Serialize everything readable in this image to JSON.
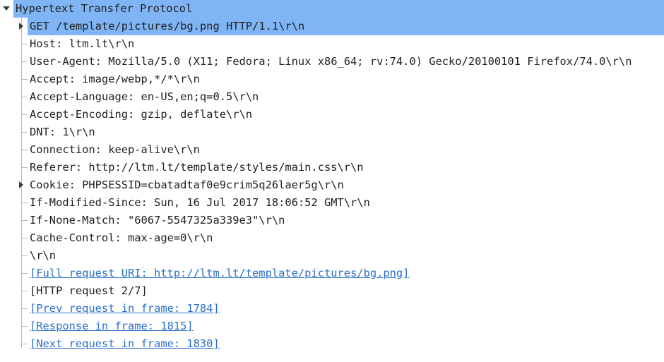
{
  "tree": {
    "root": {
      "label": "Hypertext Transfer Protocol"
    },
    "items": [
      {
        "label": "GET /template/pictures/bg.png HTTP/1.1\\r\\n",
        "expandable": true,
        "selected": true,
        "link": false
      },
      {
        "label": "Host: ltm.lt\\r\\n",
        "expandable": false,
        "link": false
      },
      {
        "label": "User-Agent: Mozilla/5.0 (X11; Fedora; Linux x86_64; rv:74.0) Gecko/20100101 Firefox/74.0\\r\\n",
        "expandable": false,
        "link": false
      },
      {
        "label": "Accept: image/webp,*/*\\r\\n",
        "expandable": false,
        "link": false
      },
      {
        "label": "Accept-Language: en-US,en;q=0.5\\r\\n",
        "expandable": false,
        "link": false
      },
      {
        "label": "Accept-Encoding: gzip, deflate\\r\\n",
        "expandable": false,
        "link": false
      },
      {
        "label": "DNT: 1\\r\\n",
        "expandable": false,
        "link": false
      },
      {
        "label": "Connection: keep-alive\\r\\n",
        "expandable": false,
        "link": false
      },
      {
        "label": "Referer: http://ltm.lt/template/styles/main.css\\r\\n",
        "expandable": false,
        "link": false
      },
      {
        "label": "Cookie: PHPSESSID=cbatadtaf0e9crim5q26laer5g\\r\\n",
        "expandable": true,
        "link": false
      },
      {
        "label": "If-Modified-Since: Sun, 16 Jul 2017 18:06:52 GMT\\r\\n",
        "expandable": false,
        "link": false
      },
      {
        "label": "If-None-Match: \"6067-5547325a339e3\"\\r\\n",
        "expandable": false,
        "link": false
      },
      {
        "label": "Cache-Control: max-age=0\\r\\n",
        "expandable": false,
        "link": false
      },
      {
        "label": "\\r\\n",
        "expandable": false,
        "link": false
      },
      {
        "label": "[Full request URI: http://ltm.lt/template/pictures/bg.png]",
        "expandable": false,
        "link": true
      },
      {
        "label": "[HTTP request 2/7]",
        "expandable": false,
        "link": false
      },
      {
        "label": "[Prev request in frame: 1784]",
        "expandable": false,
        "link": true
      },
      {
        "label": "[Response in frame: 1815]",
        "expandable": false,
        "link": true
      },
      {
        "label": "[Next request in frame: 1830]",
        "expandable": false,
        "link": true
      }
    ]
  },
  "colors": {
    "selection": "#7fb5f5",
    "link": "#2a6fc9",
    "text": "#1f1f1f",
    "tree_line": "#b8b8b8"
  },
  "icons": {
    "expanded": "triangle-down-icon",
    "collapsed": "triangle-right-icon"
  }
}
